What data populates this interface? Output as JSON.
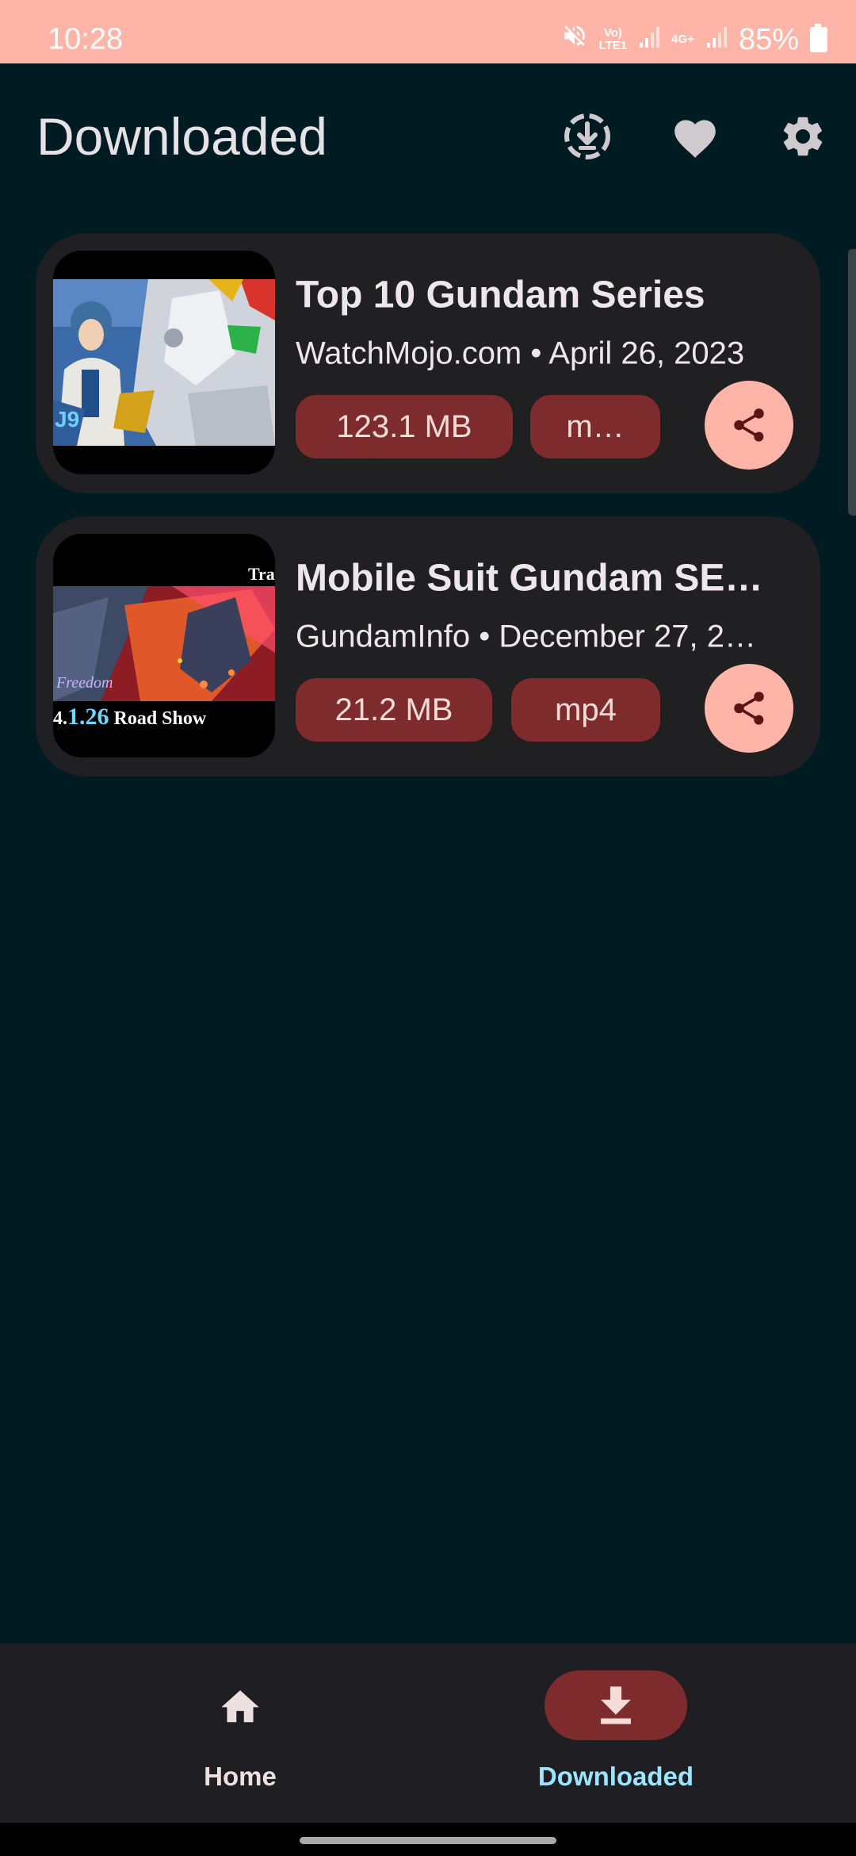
{
  "status_bar": {
    "time": "10:28",
    "volte_line1": "Vo)",
    "volte_line2": "LTE1",
    "network": "4G+",
    "battery": "85%"
  },
  "header": {
    "title": "Downloaded",
    "icons": [
      "download-progress-icon",
      "heart-icon",
      "settings-icon"
    ]
  },
  "downloads": [
    {
      "title": "Top 10 Gundam Series",
      "meta": "WatchMojo.com • April 26, 2023",
      "size": "123.1 MB",
      "format": "m…"
    },
    {
      "title": "Mobile Suit Gundam SEE…",
      "meta": "GundamInfo • December 27, 2…",
      "size": "21.2 MB",
      "format": "mp4",
      "thumb_text_top": "Tra",
      "thumb_text_prefix": "4.",
      "thumb_text_date": "1.26",
      "thumb_text_suffix": " Road Show"
    }
  ],
  "bottom_nav": {
    "items": [
      {
        "label": "Home",
        "icon": "home-icon",
        "active": false
      },
      {
        "label": "Downloaded",
        "icon": "download-icon",
        "active": true
      }
    ]
  },
  "colors": {
    "background": "#001b21",
    "status_bar": "#ffb4a8",
    "card": "#201f22",
    "chip": "#7d2b2c",
    "share_button": "#ffb4a8",
    "active_nav_label": "#9ce5ff"
  }
}
